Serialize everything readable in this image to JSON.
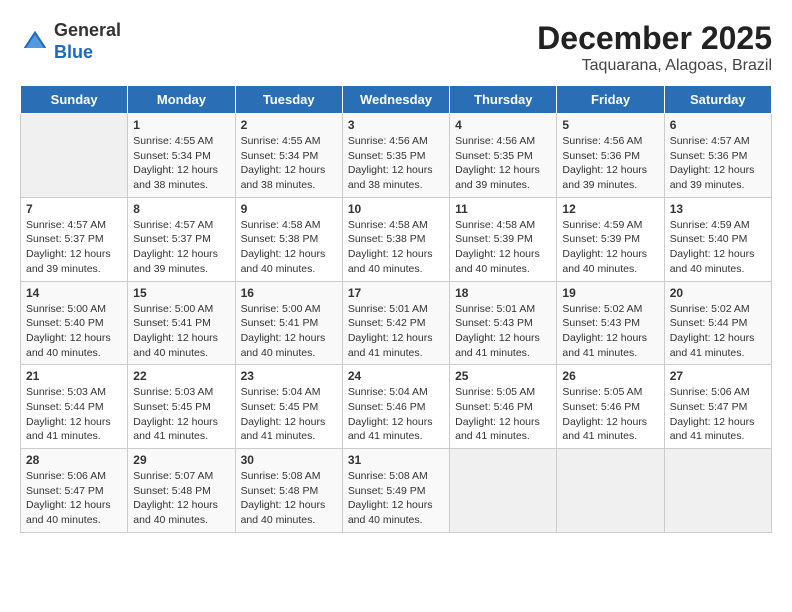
{
  "header": {
    "logo_general": "General",
    "logo_blue": "Blue",
    "main_title": "December 2025",
    "subtitle": "Taquarana, Alagoas, Brazil"
  },
  "columns": [
    "Sunday",
    "Monday",
    "Tuesday",
    "Wednesday",
    "Thursday",
    "Friday",
    "Saturday"
  ],
  "weeks": [
    [
      {
        "day": "",
        "info": ""
      },
      {
        "day": "1",
        "info": "Sunrise: 4:55 AM\nSunset: 5:34 PM\nDaylight: 12 hours\nand 38 minutes."
      },
      {
        "day": "2",
        "info": "Sunrise: 4:55 AM\nSunset: 5:34 PM\nDaylight: 12 hours\nand 38 minutes."
      },
      {
        "day": "3",
        "info": "Sunrise: 4:56 AM\nSunset: 5:35 PM\nDaylight: 12 hours\nand 38 minutes."
      },
      {
        "day": "4",
        "info": "Sunrise: 4:56 AM\nSunset: 5:35 PM\nDaylight: 12 hours\nand 39 minutes."
      },
      {
        "day": "5",
        "info": "Sunrise: 4:56 AM\nSunset: 5:36 PM\nDaylight: 12 hours\nand 39 minutes."
      },
      {
        "day": "6",
        "info": "Sunrise: 4:57 AM\nSunset: 5:36 PM\nDaylight: 12 hours\nand 39 minutes."
      }
    ],
    [
      {
        "day": "7",
        "info": "Sunrise: 4:57 AM\nSunset: 5:37 PM\nDaylight: 12 hours\nand 39 minutes."
      },
      {
        "day": "8",
        "info": "Sunrise: 4:57 AM\nSunset: 5:37 PM\nDaylight: 12 hours\nand 39 minutes."
      },
      {
        "day": "9",
        "info": "Sunrise: 4:58 AM\nSunset: 5:38 PM\nDaylight: 12 hours\nand 40 minutes."
      },
      {
        "day": "10",
        "info": "Sunrise: 4:58 AM\nSunset: 5:38 PM\nDaylight: 12 hours\nand 40 minutes."
      },
      {
        "day": "11",
        "info": "Sunrise: 4:58 AM\nSunset: 5:39 PM\nDaylight: 12 hours\nand 40 minutes."
      },
      {
        "day": "12",
        "info": "Sunrise: 4:59 AM\nSunset: 5:39 PM\nDaylight: 12 hours\nand 40 minutes."
      },
      {
        "day": "13",
        "info": "Sunrise: 4:59 AM\nSunset: 5:40 PM\nDaylight: 12 hours\nand 40 minutes."
      }
    ],
    [
      {
        "day": "14",
        "info": "Sunrise: 5:00 AM\nSunset: 5:40 PM\nDaylight: 12 hours\nand 40 minutes."
      },
      {
        "day": "15",
        "info": "Sunrise: 5:00 AM\nSunset: 5:41 PM\nDaylight: 12 hours\nand 40 minutes."
      },
      {
        "day": "16",
        "info": "Sunrise: 5:00 AM\nSunset: 5:41 PM\nDaylight: 12 hours\nand 40 minutes."
      },
      {
        "day": "17",
        "info": "Sunrise: 5:01 AM\nSunset: 5:42 PM\nDaylight: 12 hours\nand 41 minutes."
      },
      {
        "day": "18",
        "info": "Sunrise: 5:01 AM\nSunset: 5:43 PM\nDaylight: 12 hours\nand 41 minutes."
      },
      {
        "day": "19",
        "info": "Sunrise: 5:02 AM\nSunset: 5:43 PM\nDaylight: 12 hours\nand 41 minutes."
      },
      {
        "day": "20",
        "info": "Sunrise: 5:02 AM\nSunset: 5:44 PM\nDaylight: 12 hours\nand 41 minutes."
      }
    ],
    [
      {
        "day": "21",
        "info": "Sunrise: 5:03 AM\nSunset: 5:44 PM\nDaylight: 12 hours\nand 41 minutes."
      },
      {
        "day": "22",
        "info": "Sunrise: 5:03 AM\nSunset: 5:45 PM\nDaylight: 12 hours\nand 41 minutes."
      },
      {
        "day": "23",
        "info": "Sunrise: 5:04 AM\nSunset: 5:45 PM\nDaylight: 12 hours\nand 41 minutes."
      },
      {
        "day": "24",
        "info": "Sunrise: 5:04 AM\nSunset: 5:46 PM\nDaylight: 12 hours\nand 41 minutes."
      },
      {
        "day": "25",
        "info": "Sunrise: 5:05 AM\nSunset: 5:46 PM\nDaylight: 12 hours\nand 41 minutes."
      },
      {
        "day": "26",
        "info": "Sunrise: 5:05 AM\nSunset: 5:46 PM\nDaylight: 12 hours\nand 41 minutes."
      },
      {
        "day": "27",
        "info": "Sunrise: 5:06 AM\nSunset: 5:47 PM\nDaylight: 12 hours\nand 41 minutes."
      }
    ],
    [
      {
        "day": "28",
        "info": "Sunrise: 5:06 AM\nSunset: 5:47 PM\nDaylight: 12 hours\nand 40 minutes."
      },
      {
        "day": "29",
        "info": "Sunrise: 5:07 AM\nSunset: 5:48 PM\nDaylight: 12 hours\nand 40 minutes."
      },
      {
        "day": "30",
        "info": "Sunrise: 5:08 AM\nSunset: 5:48 PM\nDaylight: 12 hours\nand 40 minutes."
      },
      {
        "day": "31",
        "info": "Sunrise: 5:08 AM\nSunset: 5:49 PM\nDaylight: 12 hours\nand 40 minutes."
      },
      {
        "day": "",
        "info": ""
      },
      {
        "day": "",
        "info": ""
      },
      {
        "day": "",
        "info": ""
      }
    ]
  ]
}
